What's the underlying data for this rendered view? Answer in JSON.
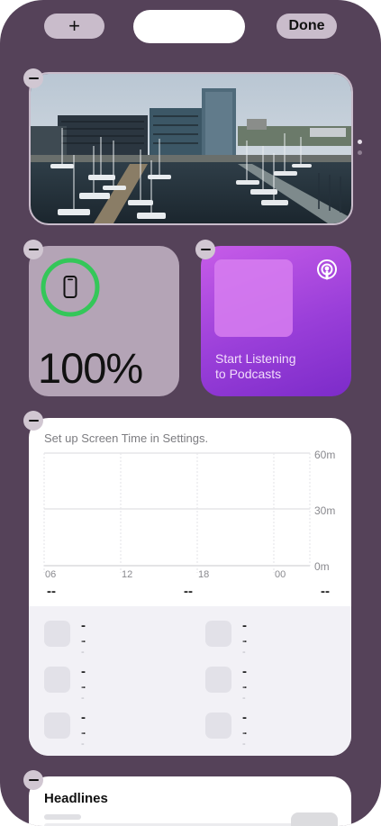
{
  "toolbar": {
    "add_label": "+",
    "done_label": "Done"
  },
  "photo_widget": {
    "icon": "harbor-photo"
  },
  "page_indicator": {
    "pages": 2,
    "active_index": 0
  },
  "battery_widget": {
    "percent_label": "100%",
    "level_fraction": 1.0,
    "icon": "iphone-icon",
    "ring_color": "#34c759"
  },
  "podcasts_widget": {
    "line1": "Start Listening",
    "line2": "to Podcasts",
    "icon": "podcasts-icon"
  },
  "screen_time_widget": {
    "title": "Set up Screen Time in Settings.",
    "y_ticks": [
      "60m",
      "30m",
      "0m"
    ],
    "x_ticks": [
      "06",
      "12",
      "18",
      "00"
    ],
    "summaries": [
      "--",
      "--",
      "--"
    ],
    "apps": [
      {
        "name": "--",
        "time": "--"
      },
      {
        "name": "--",
        "time": "--"
      },
      {
        "name": "--",
        "time": "--"
      },
      {
        "name": "--",
        "time": "--"
      },
      {
        "name": "--",
        "time": "--"
      },
      {
        "name": "--",
        "time": "--"
      }
    ]
  },
  "headlines_widget": {
    "title": "Headlines"
  }
}
